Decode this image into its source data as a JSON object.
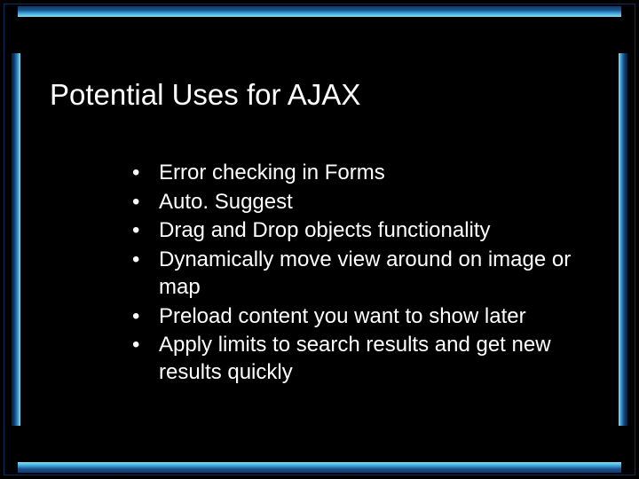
{
  "title": "Potential Uses for AJAX",
  "bullets": [
    "Error checking in Forms",
    "Auto. Suggest",
    "Drag and Drop objects functionality",
    "Dynamically move view around on image or map",
    "Preload content you want to show later",
    "Apply limits to search results and get new results quickly"
  ]
}
